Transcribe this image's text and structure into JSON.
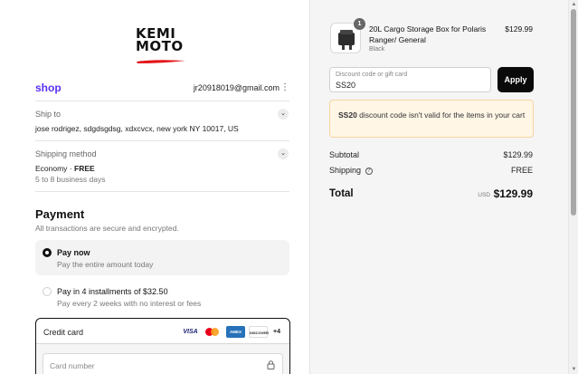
{
  "brand": {
    "line1": "KEMI",
    "line2": "MOTO",
    "swoosh_color": "#e3171b"
  },
  "shop_pay": {
    "logo_text": "shop",
    "color": "#5a31f4"
  },
  "account": {
    "email": "jr20918019@gmail.com",
    "menu_icon": "kebab-icon"
  },
  "ship_to": {
    "label": "Ship to",
    "value": "jose rodrigez, sdgdsgdsg, xdxcvcx, new york NY 10017, US"
  },
  "shipping_method": {
    "label": "Shipping method",
    "method": "Economy",
    "separator": " · ",
    "price": "FREE",
    "eta": "5 to 8 business days"
  },
  "payment": {
    "title": "Payment",
    "subtitle": "All transactions are secure and encrypted.",
    "options": [
      {
        "title": "Pay now",
        "desc": "Pay the entire amount today",
        "selected": true
      },
      {
        "title": "Pay in 4 installments of $32.50",
        "desc": "Pay every 2 weeks with no interest or fees",
        "selected": false
      }
    ],
    "card": {
      "label": "Credit card",
      "brands": [
        "VISA",
        "Mastercard",
        "AMERICAN EXPRESS",
        "DISCOVER"
      ],
      "more": "+4",
      "number_placeholder": "Card number"
    }
  },
  "order": {
    "product": {
      "qty": "1",
      "name": "20L Cargo Storage Box for Polaris Ranger/ General",
      "variant": "Black",
      "price": "$129.99"
    },
    "discount": {
      "placeholder": "Discount code or gift card",
      "value": "SS20",
      "apply_label": "Apply",
      "error_code": "SS20",
      "error_message": " discount code isn't valid for the items in your cart"
    },
    "summary": {
      "subtotal_label": "Subtotal",
      "subtotal_value": "$129.99",
      "shipping_label": "Shipping",
      "shipping_value": "FREE",
      "total_label": "Total",
      "currency": "USD",
      "total_value": "$129.99"
    }
  }
}
